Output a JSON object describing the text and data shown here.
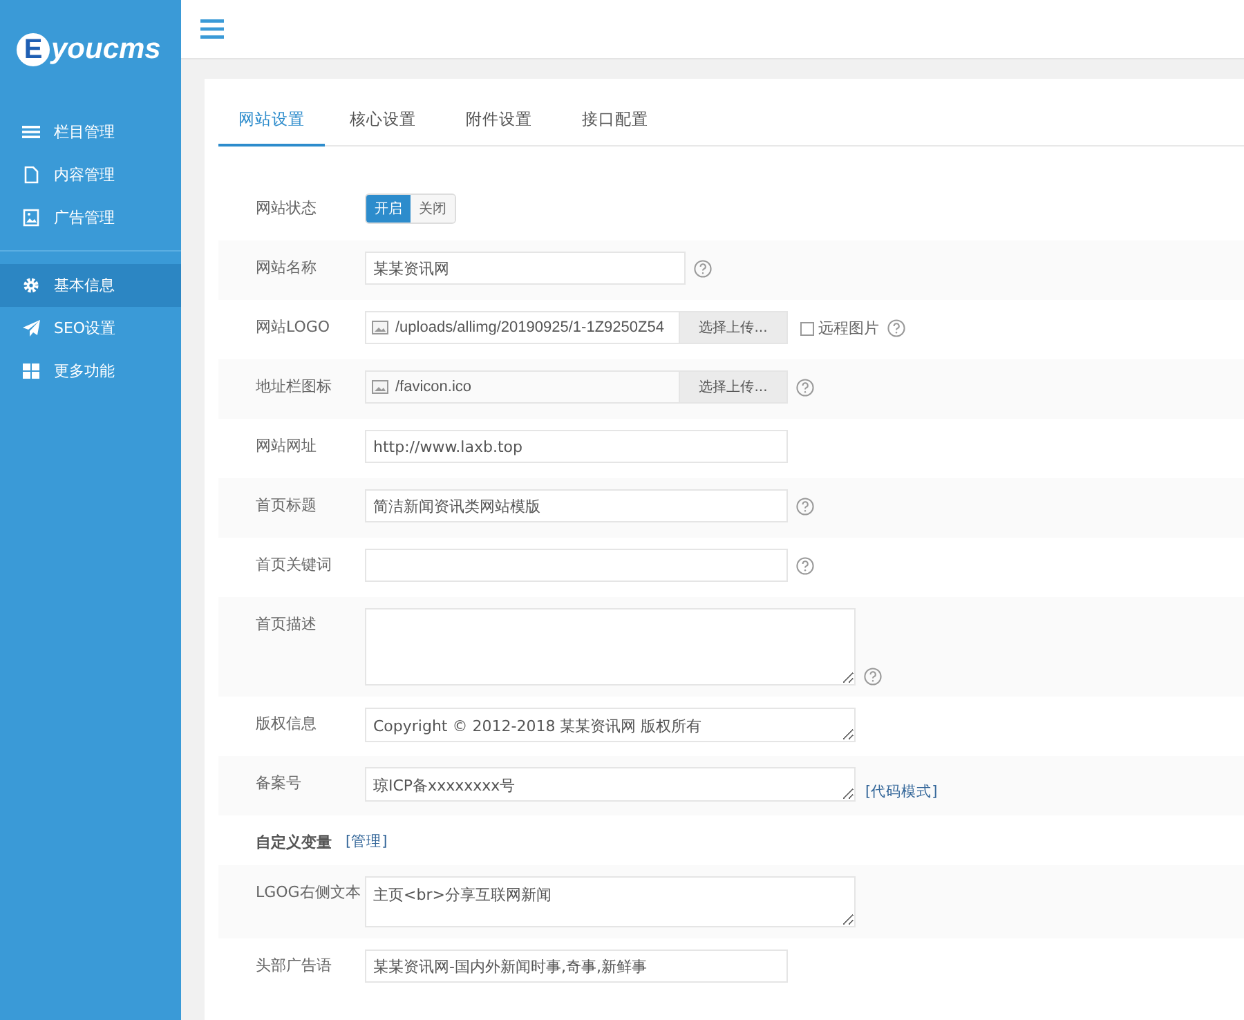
{
  "logo": {
    "mark": "E",
    "text": "youcms"
  },
  "sidebar": {
    "groups": [
      {
        "items": [
          {
            "label": "栏目管理",
            "selected": false
          },
          {
            "label": "内容管理",
            "selected": false
          },
          {
            "label": "广告管理",
            "selected": false
          }
        ]
      },
      {
        "items": [
          {
            "label": "基本信息",
            "selected": true
          },
          {
            "label": "SEO设置",
            "selected": false
          },
          {
            "label": "更多功能",
            "selected": false
          }
        ]
      }
    ]
  },
  "tabs": [
    {
      "label": "网站设置",
      "selected": true
    },
    {
      "label": "核心设置",
      "selected": false
    },
    {
      "label": "附件设置",
      "selected": false
    },
    {
      "label": "接口配置",
      "selected": false
    }
  ],
  "form": [
    {
      "kind": "toggle",
      "label": "网站状态",
      "options": [
        {
          "label": "开启",
          "selected": true
        },
        {
          "label": "关闭",
          "selected": false
        }
      ]
    },
    {
      "kind": "short",
      "label": "网站名称",
      "value": "某某资讯网",
      "help": true
    },
    {
      "kind": "upload",
      "label": "网站LOGO",
      "value": "/uploads/allimg/20190925/1-1Z9250Z54",
      "button": "选择上传...",
      "checkbox": {
        "label": "远程图片",
        "checked": false
      },
      "help": true
    },
    {
      "kind": "upload",
      "label": "地址栏图标",
      "value": "/favicon.ico",
      "button": "选择上传...",
      "help": true
    },
    {
      "kind": "text",
      "label": "网站网址",
      "value": "http://www.laxb.top",
      "help": false
    },
    {
      "kind": "text",
      "label": "首页标题",
      "value": "简洁新闻资讯类网站模版",
      "help": true
    },
    {
      "kind": "text",
      "label": "首页关键词",
      "help": true
    },
    {
      "kind": "textarea",
      "label": "首页描述",
      "help": true
    },
    {
      "kind": "line",
      "label": "版权信息",
      "value": "Copyright © 2012-2018 某某资讯网 版权所有",
      "help": false
    },
    {
      "kind": "line",
      "label": "备案号",
      "value": "琼ICP备xxxxxxxx号",
      "help": false,
      "link": "[代码模式]"
    },
    {
      "kind": "section",
      "label": "自定义变量",
      "link": "[管理]"
    },
    {
      "kind": "box",
      "label": "LGOG右侧文本",
      "value": "主页<br>分享互联网新闻",
      "help": false
    },
    {
      "kind": "text",
      "label": "头部广告语",
      "value": "某某资讯网-国内外新闻时事,奇事,新鲜事",
      "help": false
    }
  ]
}
